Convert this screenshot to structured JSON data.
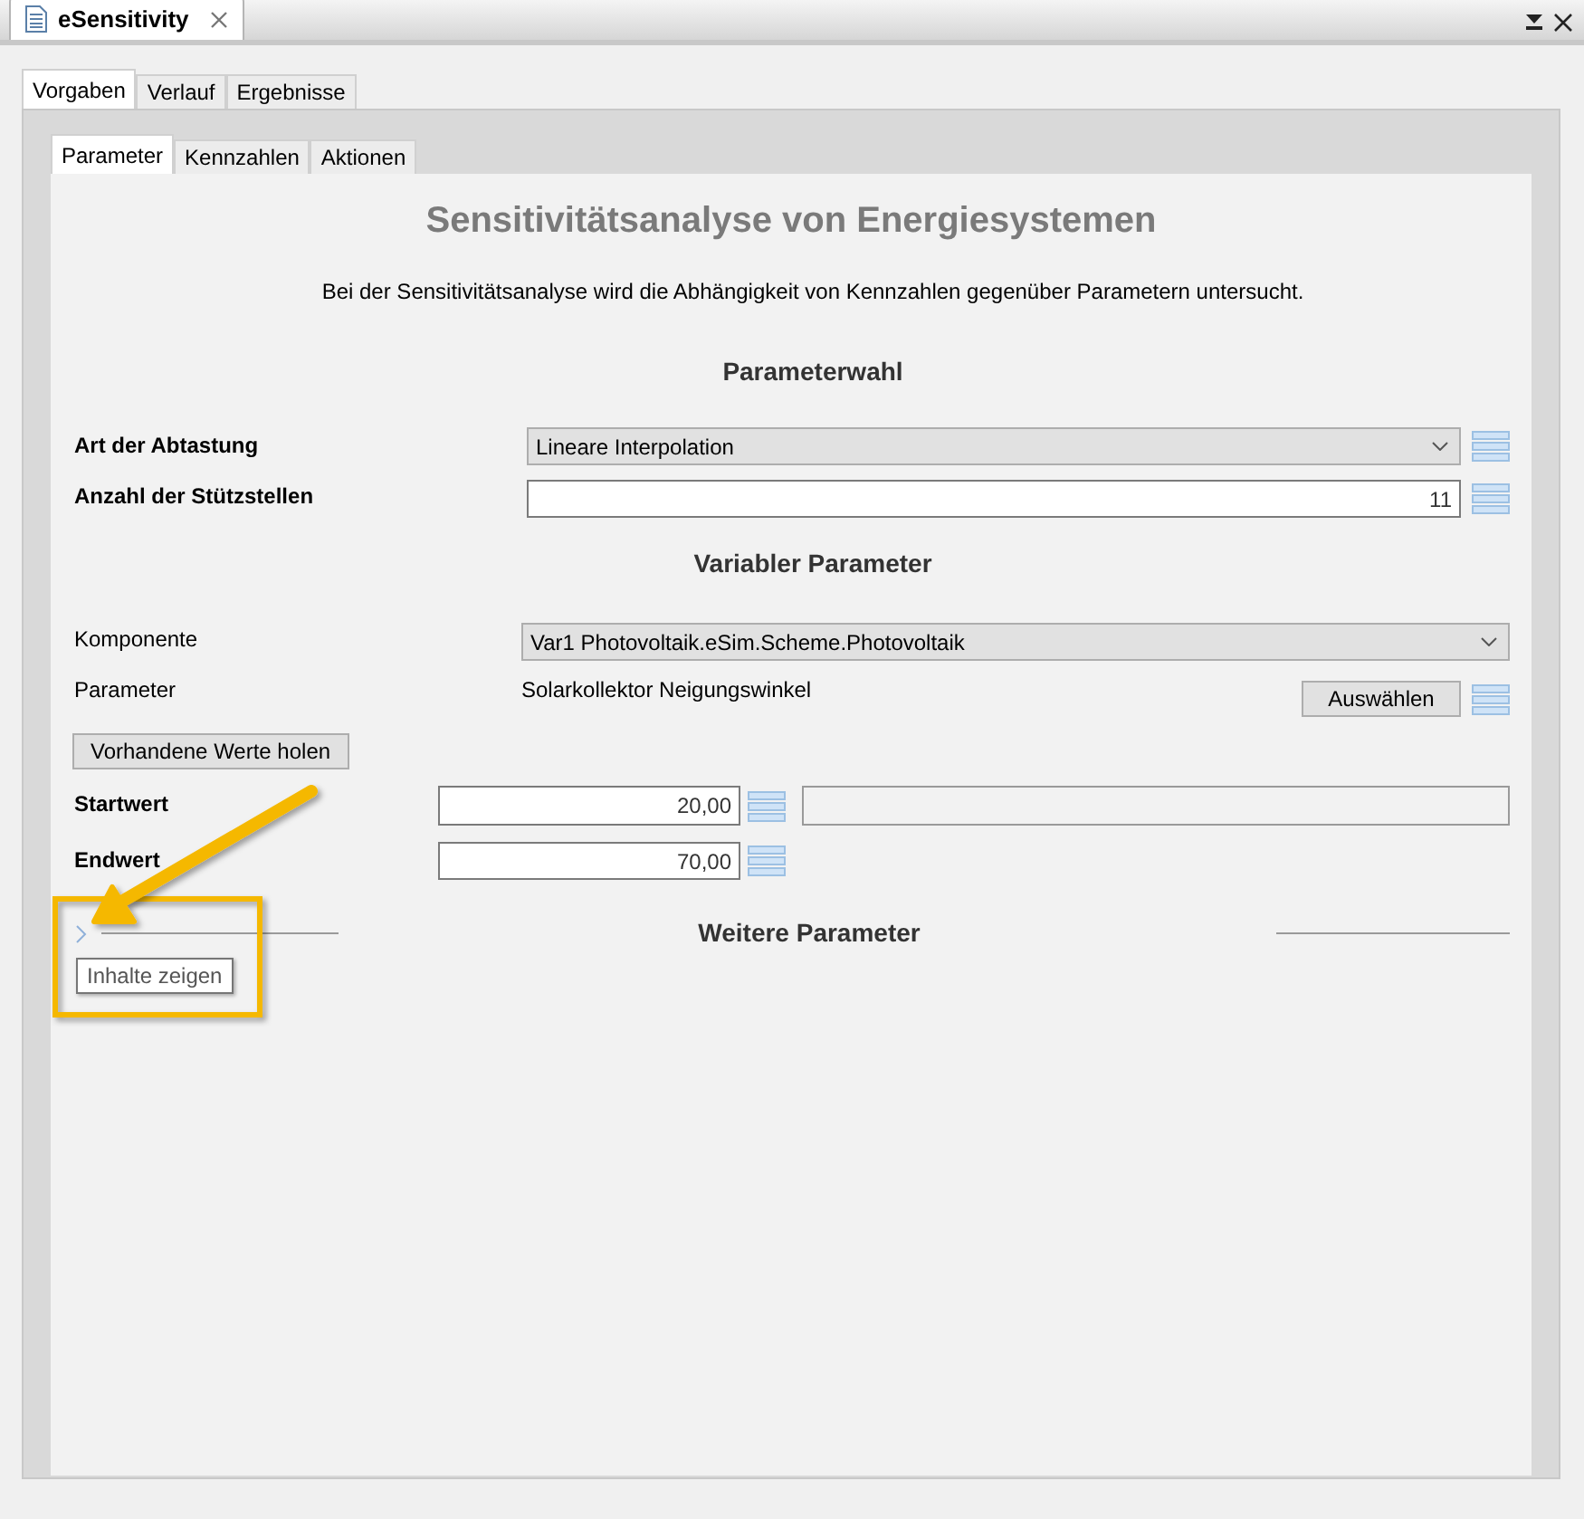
{
  "editor_tab": {
    "title": "eSensitivity"
  },
  "outer_tabs": [
    {
      "label": "Vorgaben",
      "selected": true
    },
    {
      "label": "Verlauf",
      "selected": false
    },
    {
      "label": "Ergebnisse",
      "selected": false
    }
  ],
  "inner_tabs": [
    {
      "label": "Parameter",
      "selected": true
    },
    {
      "label": "Kennzahlen",
      "selected": false
    },
    {
      "label": "Aktionen",
      "selected": false
    }
  ],
  "title": "Sensitivitätsanalyse von Energiesystemen",
  "description": "Bei der Sensitivitätsanalyse wird die Abhängigkeit von Kennzahlen gegenüber Parametern untersucht.",
  "parameterwahl": {
    "heading": "Parameterwahl",
    "art_der_abtastung": {
      "label": "Art der Abtastung",
      "value": "Lineare Interpolation"
    },
    "anzahl_der_stuetzstellen": {
      "label": "Anzahl der Stützstellen",
      "value": "11"
    }
  },
  "variabler_parameter": {
    "heading": "Variabler Parameter",
    "komponente": {
      "label": "Komponente",
      "value": "Var1 Photovoltaik.eSim.Scheme.Photovoltaik"
    },
    "parameter": {
      "label": "Parameter",
      "value": "Solarkollektor Neigungswinkel",
      "button": "Auswählen"
    },
    "fetch_button": "Vorhandene Werte holen",
    "startwert": {
      "label": "Startwert",
      "value": "20,00"
    },
    "endwert": {
      "label": "Endwert",
      "value": "70,00"
    }
  },
  "weitere_parameter": {
    "heading": "Weitere Parameter",
    "expanded": false,
    "tooltip": "Inhalte zeigen"
  }
}
